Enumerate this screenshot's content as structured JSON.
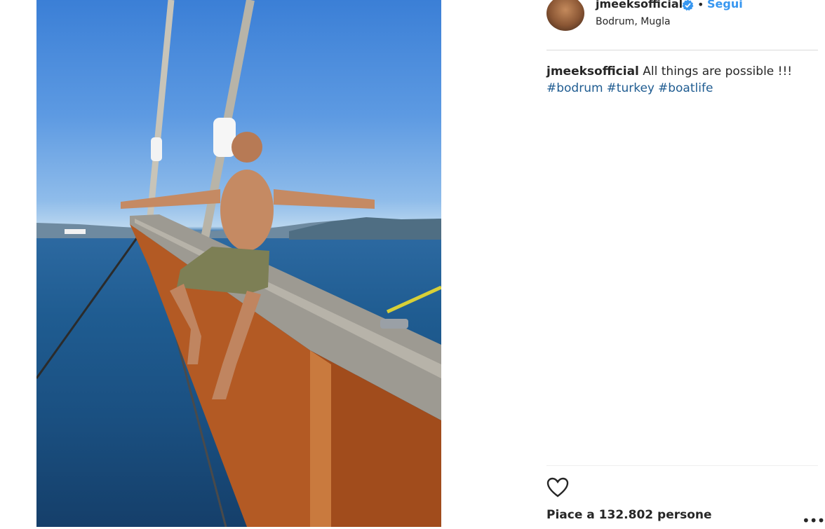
{
  "post": {
    "image_alt": "post-photo",
    "username": "jmeeksofficial",
    "separator": "•",
    "follow_label": "Segui",
    "location": "Bodrum, Mugla",
    "caption_text": "All things are possible !!!",
    "hashtags": [
      "#bodrum",
      "#turkey",
      "#boatlife"
    ],
    "likes_text": "Piace a 132.802 persone",
    "more_label": "•••"
  },
  "icons": {
    "verified": "verified-badge-icon",
    "heart": "heart-icon",
    "more": "more-options-icon"
  },
  "colors": {
    "link": "#3897f0",
    "hashtag": "#1f5c91",
    "text": "#262626",
    "divider": "#dbdbdb"
  }
}
